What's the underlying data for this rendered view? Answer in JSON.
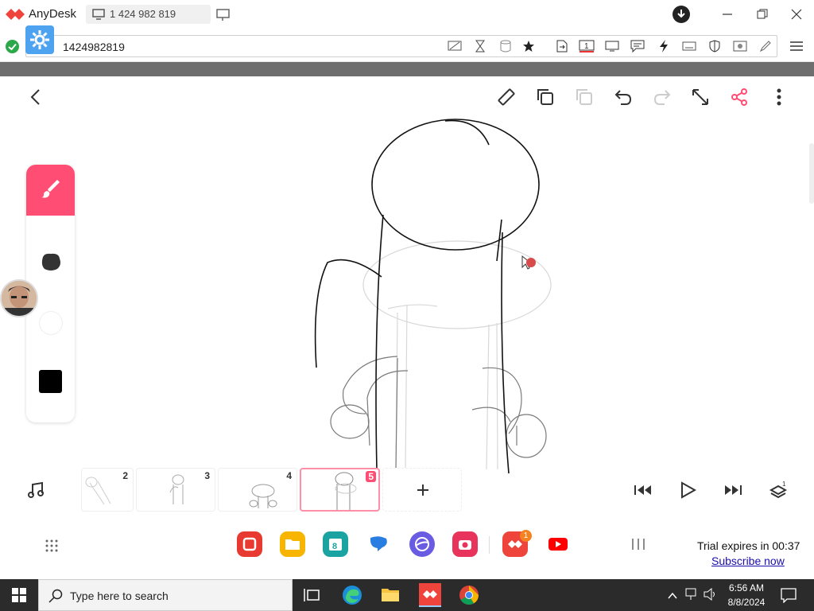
{
  "titlebar": {
    "app_name": "AnyDesk",
    "tab_label": "1 424 982 819"
  },
  "addressbar": {
    "session_id": "1424982819"
  },
  "frames": [
    {
      "num": "2"
    },
    {
      "num": "3"
    },
    {
      "num": "4"
    },
    {
      "num": "5",
      "active": true
    }
  ],
  "colors": {
    "brand": "#ef443b",
    "accent": "#ff4d74",
    "current_color": "#000000"
  },
  "trial": {
    "text": "Trial expires in 00:37",
    "link": "Subscribe now"
  },
  "taskbar": {
    "search_placeholder": "Type here to search",
    "time": "6:56 AM",
    "date": "8/8/2024"
  },
  "dock_badge": "1",
  "icons": [
    "back-icon",
    "ruler-icon",
    "copy-frame-icon",
    "paste-frame-icon",
    "undo-icon",
    "redo-icon",
    "fullscreen-icon",
    "share-icon",
    "more-icon",
    "brush-icon",
    "eraser-icon",
    "music-icon",
    "skip-start-icon",
    "play-icon",
    "skip-end-icon",
    "layers-icon"
  ]
}
